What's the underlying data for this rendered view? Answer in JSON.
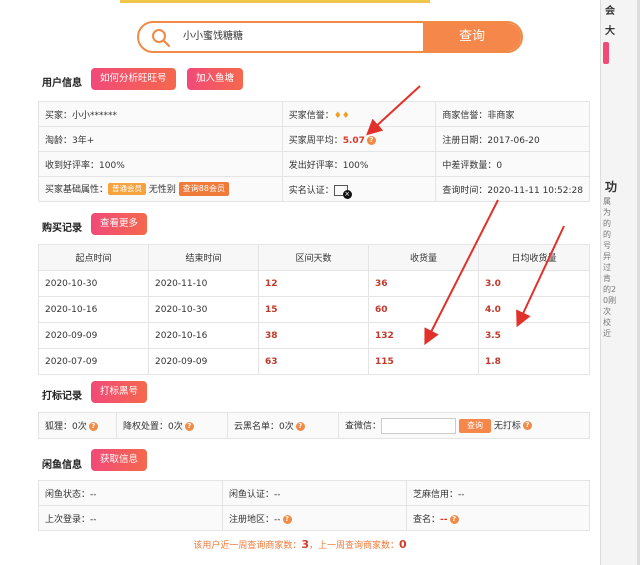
{
  "search": {
    "value": "小小蜜饯糖糖",
    "button": "查询"
  },
  "user_info": {
    "heading": "用户信息",
    "btn_analyze": "如何分析旺旺号",
    "btn_join": "加入鱼塘",
    "rows": [
      [
        "买家：",
        "小小******",
        "买家信誉：",
        "",
        "商家信誉：",
        "非商家"
      ],
      [
        "淘龄：",
        "3年+",
        "买家周平均：",
        "5.07",
        "注册日期：",
        "2017-06-20"
      ],
      [
        "收到好评率：",
        "100%",
        "发出好评率：",
        "100%",
        "中差评数量：",
        "0"
      ],
      [
        "买家基础属性：",
        "无性别",
        "实名认证：",
        "",
        "查询时间：",
        "2020-11-11 10:52:28"
      ]
    ],
    "vip_badge": "普通会员",
    "check88": "查询88会员"
  },
  "purchase": {
    "heading": "购买记录",
    "btn_more": "查看更多",
    "columns": [
      "起点时间",
      "结束时间",
      "区间天数",
      "收货量",
      "日均收货量"
    ],
    "rows": [
      [
        "2020-10-30",
        "2020-11-10",
        "12",
        "36",
        "3.0"
      ],
      [
        "2020-10-16",
        "2020-10-30",
        "15",
        "60",
        "4.0"
      ],
      [
        "2020-09-09",
        "2020-10-16",
        "38",
        "132",
        "3.5"
      ],
      [
        "2020-07-09",
        "2020-09-09",
        "63",
        "115",
        "1.8"
      ]
    ]
  },
  "marks": {
    "heading": "打标记录",
    "btn": "打标黑号",
    "fox": "狐狸：",
    "fox_val": "0次",
    "deprec": "降权处置：",
    "deprec_val": "0次",
    "cloud": "云黑名单：",
    "cloud_val": "0次",
    "wechat": "查微信：",
    "query": "查询",
    "no_mark": "无打标"
  },
  "xianyu": {
    "heading": "闲鱼信息",
    "btn": "获取信息",
    "rows": [
      [
        "闲鱼状态：",
        "--",
        "闲鱼认证：",
        "--",
        "芝麻信用：",
        "--"
      ],
      [
        "上次登录：",
        "--",
        "注册地区：",
        "--",
        "查名：",
        "--"
      ]
    ]
  },
  "footer": {
    "prefix": "该用户近一周查询商家数：",
    "week": "3",
    "mid": "，上一周查询商家数：",
    "prev": "0"
  },
  "right_panel": {
    "char1": "会",
    "char2": "大",
    "char3": "功",
    "lines": "属为的的号异过肯的20刚次校近"
  },
  "colors": {
    "accent": "#f5874a",
    "pink": "#f14a79",
    "red": "#d83a2a"
  }
}
